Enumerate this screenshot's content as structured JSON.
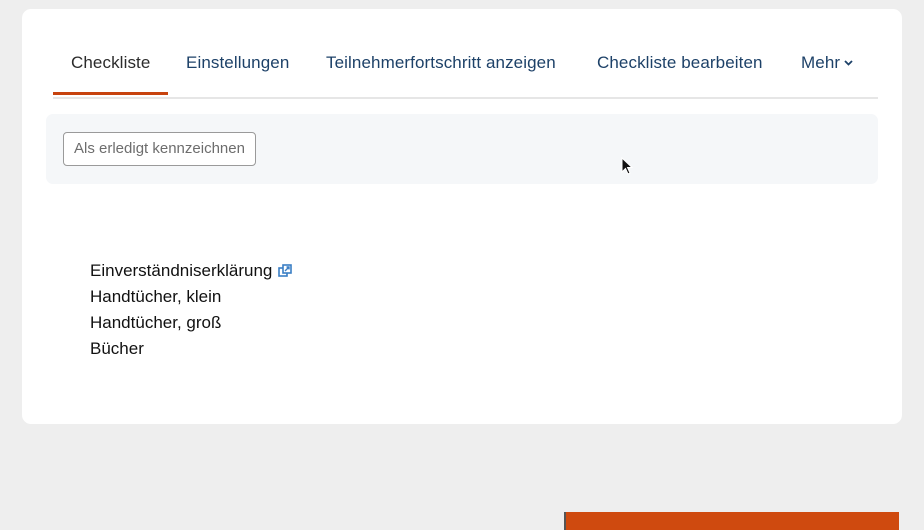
{
  "tabs": [
    {
      "label": "Checkliste",
      "active": true
    },
    {
      "label": "Einstellungen",
      "active": false
    },
    {
      "label": "Teilnehmerfortschritt anzeigen",
      "active": false
    },
    {
      "label": "Checkliste bearbeiten",
      "active": false
    },
    {
      "label": "Mehr",
      "active": false
    }
  ],
  "action_bar": {
    "mark_done_label": "Als erledigt kennzeichnen"
  },
  "items": [
    {
      "label": "Einverständniserklärung",
      "icon": "external-link-icon"
    },
    {
      "label": "Handtücher, klein"
    },
    {
      "label": "Handtücher, groß"
    },
    {
      "label": "Bücher"
    }
  ],
  "colors": {
    "accent": "#c7430e",
    "tab_text": "#1d4168",
    "link_icon": "#3a7ec5"
  }
}
